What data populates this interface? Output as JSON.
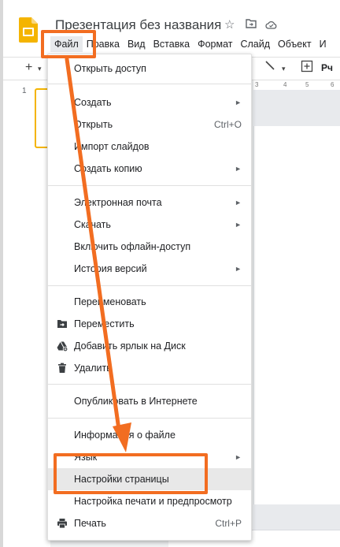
{
  "app": {
    "title": "Презентация без названия",
    "menubar": [
      "Файл",
      "Правка",
      "Вид",
      "Вставка",
      "Формат",
      "Слайд",
      "Объект",
      "И"
    ],
    "toolbar": {
      "plus": "+",
      "text_tool": "Рч"
    },
    "ruler": [
      "3",
      "4",
      "5",
      "6"
    ],
    "slide_number": "1",
    "accent_color": "#f4b400"
  },
  "file_menu": {
    "items": [
      {
        "label": "Открыть доступ",
        "icon": "",
        "shortcut": "",
        "submenu": false
      },
      {
        "label": "Создать",
        "icon": "",
        "shortcut": "",
        "submenu": true
      },
      {
        "label": "Открыть",
        "icon": "",
        "shortcut": "Ctrl+O",
        "submenu": false
      },
      {
        "label": "Импорт слайдов",
        "icon": "",
        "shortcut": "",
        "submenu": false
      },
      {
        "label": "Создать копию",
        "icon": "",
        "shortcut": "",
        "submenu": true
      },
      {
        "label": "Электронная почта",
        "icon": "",
        "shortcut": "",
        "submenu": true
      },
      {
        "label": "Скачать",
        "icon": "",
        "shortcut": "",
        "submenu": true
      },
      {
        "label": "Включить офлайн-доступ",
        "icon": "",
        "shortcut": "",
        "submenu": false
      },
      {
        "label": "История версий",
        "icon": "",
        "shortcut": "",
        "submenu": true
      },
      {
        "label": "Переименовать",
        "icon": "",
        "shortcut": "",
        "submenu": false
      },
      {
        "label": "Переместить",
        "icon": "move-to-folder-icon",
        "shortcut": "",
        "submenu": false
      },
      {
        "label": "Добавить ярлык на Диск",
        "icon": "drive-shortcut-icon",
        "shortcut": "",
        "submenu": false
      },
      {
        "label": "Удалить",
        "icon": "trash-icon",
        "shortcut": "",
        "submenu": false
      },
      {
        "label": "Опубликовать в Интернете",
        "icon": "",
        "shortcut": "",
        "submenu": false
      },
      {
        "label": "Информация о файле",
        "icon": "",
        "shortcut": "",
        "submenu": false
      },
      {
        "label": "Язык",
        "icon": "",
        "shortcut": "",
        "submenu": true
      },
      {
        "label": "Настройки страницы",
        "icon": "",
        "shortcut": "",
        "submenu": false
      },
      {
        "label": "Настройка печати и предпросмотр",
        "icon": "",
        "shortcut": "",
        "submenu": false
      },
      {
        "label": "Печать",
        "icon": "print-icon",
        "shortcut": "Ctrl+P",
        "submenu": false
      }
    ],
    "submenu_arrow": "►"
  },
  "annotation": {
    "color": "#f26d21"
  }
}
